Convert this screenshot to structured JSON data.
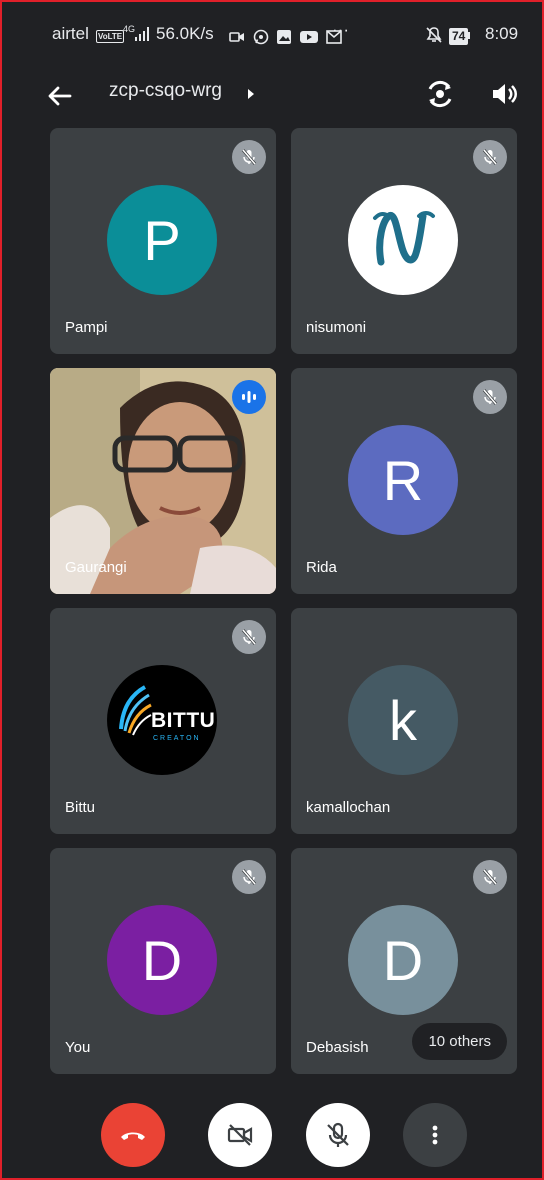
{
  "status_bar": {
    "carrier": "airtel",
    "volte": "VoLTE",
    "network": "4G",
    "speed": "56.0K/s",
    "ellipsis": "···",
    "battery": "74",
    "time": "8:09"
  },
  "header": {
    "meeting_code": "zcp-csqo-wrg"
  },
  "participants": [
    {
      "name": "Pampi",
      "avatar_letter": "P",
      "avatar_color": "#0b8e98",
      "muted": true
    },
    {
      "name": "nisumoni",
      "avatar_letter": "N",
      "avatar_color": "#ffffff",
      "muted": true
    },
    {
      "name": "Gaurangi",
      "avatar_letter": "",
      "avatar_color": "#c9b8a0",
      "muted": false,
      "speaking": true,
      "video": true
    },
    {
      "name": "Rida",
      "avatar_letter": "R",
      "avatar_color": "#5c6bc0",
      "muted": true
    },
    {
      "name": "Bittu",
      "avatar_letter": "",
      "avatar_color": "#000000",
      "muted": true,
      "logo_text": "BITTU",
      "logo_sub": "CREATON"
    },
    {
      "name": "kamallochan",
      "avatar_letter": "k",
      "avatar_color": "#455a64",
      "muted": false
    },
    {
      "name": "You",
      "avatar_letter": "D",
      "avatar_color": "#7b1fa2",
      "muted": true
    },
    {
      "name": "Debasish",
      "avatar_letter": "D",
      "avatar_color": "#78909c",
      "muted": true
    }
  ],
  "others_chip": "10 others",
  "colors": {
    "background": "#202124",
    "tile": "#3c4043",
    "end_call": "#ea4335",
    "control_light": "#ffffff",
    "control_dark": "#3c4043",
    "speaking_badge": "#1a73e8"
  },
  "icons": {
    "back": "arrow-left-icon",
    "switch_camera": "switch-camera-icon",
    "speaker": "speaker-icon",
    "mute": "mic-off-icon",
    "speaking": "audio-level-icon",
    "end_call": "phone-hangup-icon",
    "camera_off": "camera-off-icon",
    "mic_off": "mic-off-icon",
    "more": "more-vert-icon"
  }
}
